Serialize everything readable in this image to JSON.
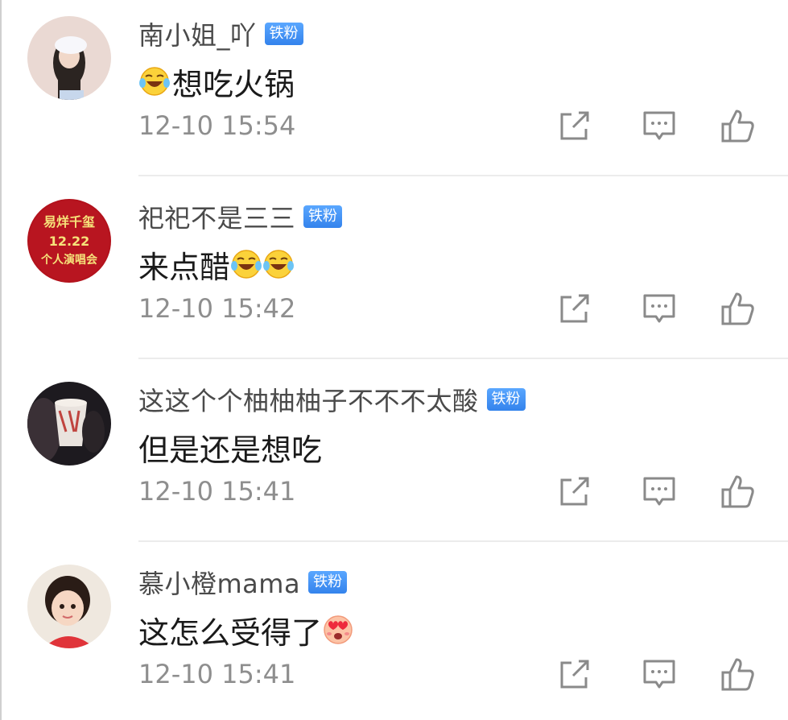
{
  "comments": [
    {
      "username": "南小姐_吖",
      "badge": "铁粉",
      "content_prefix_emoji": "laughing-crying-emoji",
      "content_text": "想吃火锅",
      "content_suffix_emojis": [],
      "timestamp": "12-10 15:54",
      "avatar": "avatar-girl-white-hat"
    },
    {
      "username": "祀祀不是三三",
      "badge": "铁粉",
      "content_prefix_emoji": "",
      "content_text": "来点醋",
      "content_suffix_emojis": [
        "laughing-crying-emoji",
        "laughing-crying-emoji"
      ],
      "timestamp": "12-10 15:42",
      "avatar": "avatar-red-concert-poster",
      "avatar_text": [
        "易烊千玺",
        "12.22",
        "个人演唱会"
      ]
    },
    {
      "username": "这这个个柚柚柚子不不不太酸",
      "badge": "铁粉",
      "content_prefix_emoji": "",
      "content_text": "但是还是想吃",
      "content_suffix_emojis": [],
      "timestamp": "12-10 15:41",
      "avatar": "avatar-dark-popcorn-cup"
    },
    {
      "username": "慕小橙mama",
      "badge": "铁粉",
      "content_prefix_emoji": "",
      "content_text": "这怎么受得了",
      "content_suffix_emojis": [
        "heart-eyes-emoji"
      ],
      "timestamp": "12-10 15:41",
      "avatar": "avatar-child-photo"
    }
  ],
  "actions": [
    "share-icon",
    "reply-icon",
    "like-icon"
  ],
  "colors": {
    "username": "#4a4a4a",
    "content": "#1a1a1a",
    "timestamp": "#8e8e8e",
    "badge": "#3d8ff2",
    "icon": "#8a8a8a",
    "divider": "#ececec"
  }
}
